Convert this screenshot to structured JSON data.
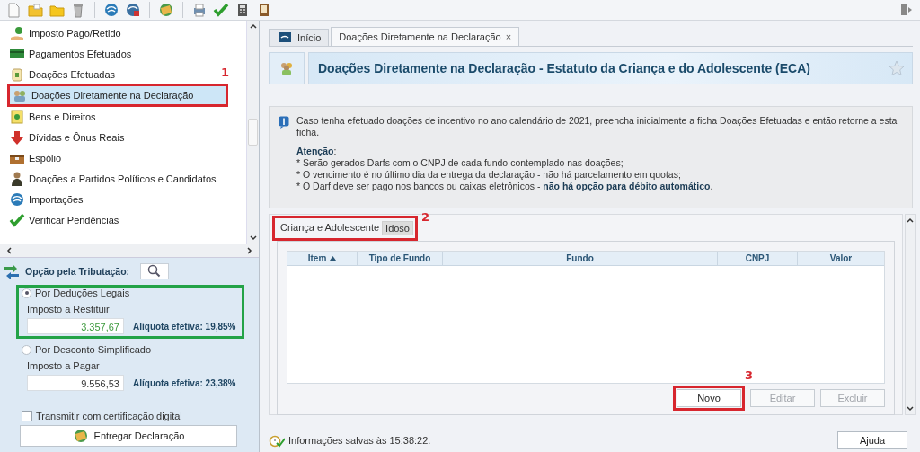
{
  "tabs": [
    {
      "label": "Início",
      "selected": false
    },
    {
      "label": "Doações Diretamente na Declaração",
      "selected": true,
      "close": "×"
    }
  ],
  "sidebar": {
    "items": [
      {
        "label": "Imposto Pago/Retido",
        "selected": false
      },
      {
        "label": "Pagamentos Efetuados",
        "selected": false
      },
      {
        "label": "Doações Efetuadas",
        "selected": false
      },
      {
        "label": "Doações Diretamente na Declaração",
        "selected": true
      },
      {
        "label": "Bens e Direitos",
        "selected": false
      },
      {
        "label": "Dívidas e Ônus Reais",
        "selected": false
      },
      {
        "label": "Espólio",
        "selected": false
      },
      {
        "label": "Doações a Partidos Políticos e Candidatos",
        "selected": false
      },
      {
        "label": "Importações",
        "selected": false
      },
      {
        "label": "Verificar Pendências",
        "selected": false
      }
    ]
  },
  "tax_option": {
    "title": "Opção pela Tributação:",
    "options": [
      {
        "label": "Por Deduções Legais",
        "selected": true,
        "amount_label": "Imposto a Restituir",
        "amount": "3.357,67",
        "color": "#3d9a3d",
        "rate": "Alíquota efetiva: 19,85%"
      },
      {
        "label": "Por Desconto Simplificado",
        "selected": false,
        "amount_label": "Imposto a Pagar",
        "amount": "9.556,53",
        "color": "#333333",
        "rate": "Alíquota efetiva: 23,38%"
      }
    ],
    "certificate": {
      "label": "Transmitir com certificação digital",
      "checked": false
    },
    "submit_button": "Entregar Declaração"
  },
  "header": {
    "title": "Doações Diretamente na Declaração - Estatuto da Criança e do Adolescente (ECA)"
  },
  "info": {
    "text": "Caso tenha efetuado doações de incentivo no ano calendário de 2021, preencha inicialmente a ficha Doações Efetuadas e então retorne a esta ficha.",
    "attention": "**Atenção**:",
    "bullets": [
      "* Serão gerados Darfs com o CNPJ de cada fundo contemplado nas doações;",
      "* O vencimento é no último dia da entrega da declaração - não há parcelamento em quotas;",
      "* O Darf deve ser pago nos bancos ou caixas eletrônicos - **não há opção para débito automático**."
    ]
  },
  "fund_tabs": [
    {
      "label": "Criança e Adolescente",
      "selected": true
    },
    {
      "label": "Idoso",
      "selected": false
    }
  ],
  "table": {
    "columns": [
      {
        "label": "Item",
        "sorted": true
      },
      {
        "label": "Tipo de Fundo",
        "sorted": false
      },
      {
        "label": "Fundo",
        "sorted": false
      },
      {
        "label": "CNPJ",
        "sorted": false
      },
      {
        "label": "Valor",
        "sorted": false
      }
    ]
  },
  "buttons": [
    {
      "label": "Novo",
      "disabled": false
    },
    {
      "label": "Editar",
      "disabled": true
    },
    {
      "label": "Excluir",
      "disabled": true
    }
  ],
  "status_bar": {
    "text": "Informações salvas às 15:38:22.",
    "help_button": "Ajuda"
  },
  "annotations": [
    {
      "label": "1",
      "color": "#d7262e"
    },
    {
      "label": "2",
      "color": "#d7262e"
    },
    {
      "label": "3",
      "color": "#d7262e"
    },
    {
      "color": "#23a347"
    }
  ]
}
